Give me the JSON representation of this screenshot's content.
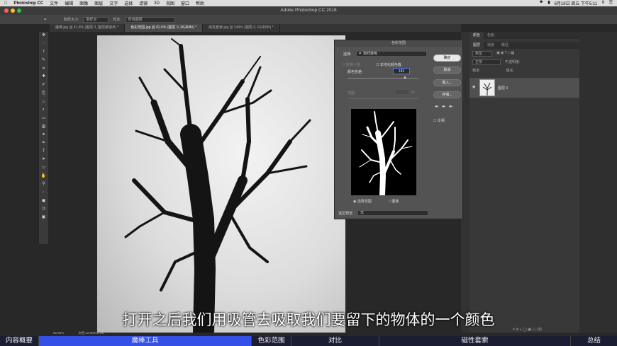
{
  "macbar": {
    "app": "Photoshop CC",
    "menus": [
      "文件",
      "编辑",
      "图像",
      "图层",
      "文字",
      "选择",
      "滤镜",
      "3D",
      "视图",
      "窗口",
      "帮助"
    ],
    "clock": "6月18日 周五 下午5:11"
  },
  "window": {
    "title": "Adobe Photoshop CC 2018"
  },
  "options": {
    "sample_size_label": "取样大小:",
    "sample_size_value": "取样点",
    "sample_label": "样本:",
    "sample_value": "所有图层"
  },
  "tabs": [
    {
      "label": "魔棒.jpg @ 41.8% (图层 0, 图层蒙版/8) *"
    },
    {
      "label": "色彩范围.jpg @ 62.6% (图层 0, RGB/8#) *"
    },
    {
      "label": "磁性套索.jpg @ 249% (图层 0, RGB/8#) *"
    }
  ],
  "tools": [
    "✥",
    "◌",
    "ℓ",
    "✎",
    "⌗",
    "✚",
    "✐",
    "⎘",
    "♨",
    "◐",
    "▭",
    "▥",
    "●",
    "✒",
    "T",
    "➤",
    "▭",
    "✋",
    "⚲",
    "⋯",
    "◼",
    "◘",
    "▣"
  ],
  "status": {
    "zoom": "62.58%",
    "doc": "文档:22.9M/22.9M"
  },
  "dialog": {
    "title": "色彩范围",
    "select_label": "选择:",
    "select_value": "取样颜色",
    "detect_faces": "检测人脸",
    "localized": "本地化颜色簇",
    "fuzziness_label": "颜色容差:",
    "fuzziness_value": "183",
    "range_label": "范围:",
    "range_unit": "%",
    "ok": "确定",
    "cancel": "取消",
    "load": "载入...",
    "save": "存储...",
    "invert": "反相",
    "radio_selection": "选择范围",
    "radio_image": "图像",
    "preview_label": "选区预览:",
    "preview_value": "无"
  },
  "panel": {
    "top_tabs": [
      "颜色",
      "色板"
    ],
    "layer_tabs": [
      "图层",
      "通道",
      "路径"
    ],
    "kind_label": "类型",
    "blend": "正常",
    "opacity_label": "不透明度:",
    "lock_label": "锁定:",
    "fill_label": "填充:",
    "layer_name": "图层 0"
  },
  "caption": "打开之后我们用吸管去吸取我们要留下的物体的一个颜色",
  "chapters": [
    {
      "label": "内容概要"
    },
    {
      "label": "魔棒工具"
    },
    {
      "label": "色彩范围"
    },
    {
      "label": "对比"
    },
    {
      "label": "磁性套索"
    },
    {
      "label": "总结"
    }
  ],
  "colors": {
    "chapter_active": "#3550e6",
    "chapter_bar": "#1b1e33",
    "ps_bg": "#282828",
    "dialog_bg": "#535353"
  }
}
